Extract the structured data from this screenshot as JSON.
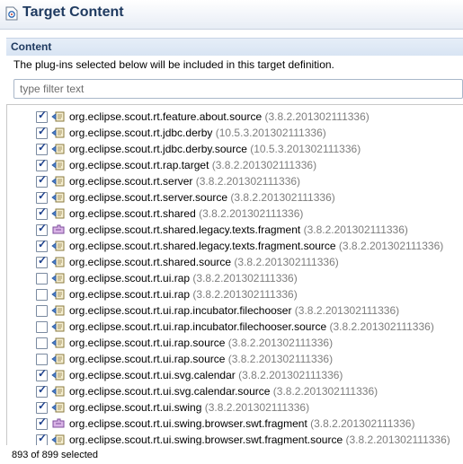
{
  "header": {
    "title": "Target Content",
    "icon": "target-definition-icon"
  },
  "section": {
    "title": "Content",
    "description": "The plug-ins selected below will be included in this target definition."
  },
  "filter": {
    "placeholder": "type filter text",
    "value": ""
  },
  "plugins": [
    {
      "name": "org.eclipse.scout.rt.feature.about.source",
      "version": "(3.8.2.201302111336)",
      "checked": true,
      "icon": "plugin-icon"
    },
    {
      "name": "org.eclipse.scout.rt.jdbc.derby",
      "version": "(10.5.3.201302111336)",
      "checked": true,
      "icon": "plugin-icon"
    },
    {
      "name": "org.eclipse.scout.rt.jdbc.derby.source",
      "version": "(10.5.3.201302111336)",
      "checked": true,
      "icon": "plugin-icon"
    },
    {
      "name": "org.eclipse.scout.rt.rap.target",
      "version": "(3.8.2.201302111336)",
      "checked": true,
      "icon": "plugin-icon"
    },
    {
      "name": "org.eclipse.scout.rt.server",
      "version": "(3.8.2.201302111336)",
      "checked": true,
      "icon": "plugin-icon"
    },
    {
      "name": "org.eclipse.scout.rt.server.source",
      "version": "(3.8.2.201302111336)",
      "checked": true,
      "icon": "plugin-icon"
    },
    {
      "name": "org.eclipse.scout.rt.shared",
      "version": "(3.8.2.201302111336)",
      "checked": true,
      "icon": "plugin-icon"
    },
    {
      "name": "org.eclipse.scout.rt.shared.legacy.texts.fragment",
      "version": "(3.8.2.201302111336)",
      "checked": true,
      "icon": "fragment-icon"
    },
    {
      "name": "org.eclipse.scout.rt.shared.legacy.texts.fragment.source",
      "version": "(3.8.2.201302111336)",
      "checked": true,
      "icon": "plugin-icon"
    },
    {
      "name": "org.eclipse.scout.rt.shared.source",
      "version": "(3.8.2.201302111336)",
      "checked": true,
      "icon": "plugin-icon"
    },
    {
      "name": "org.eclipse.scout.rt.ui.rap",
      "version": "(3.8.2.201302111336)",
      "checked": false,
      "icon": "plugin-icon"
    },
    {
      "name": "org.eclipse.scout.rt.ui.rap",
      "version": "(3.8.2.201302111336)",
      "checked": false,
      "icon": "plugin-icon"
    },
    {
      "name": "org.eclipse.scout.rt.ui.rap.incubator.filechooser",
      "version": "(3.8.2.201302111336)",
      "checked": false,
      "icon": "plugin-icon"
    },
    {
      "name": "org.eclipse.scout.rt.ui.rap.incubator.filechooser.source",
      "version": "(3.8.2.201302111336)",
      "checked": false,
      "icon": "plugin-icon"
    },
    {
      "name": "org.eclipse.scout.rt.ui.rap.source",
      "version": "(3.8.2.201302111336)",
      "checked": false,
      "icon": "plugin-icon"
    },
    {
      "name": "org.eclipse.scout.rt.ui.rap.source",
      "version": "(3.8.2.201302111336)",
      "checked": false,
      "icon": "plugin-icon"
    },
    {
      "name": "org.eclipse.scout.rt.ui.svg.calendar",
      "version": "(3.8.2.201302111336)",
      "checked": true,
      "icon": "plugin-icon"
    },
    {
      "name": "org.eclipse.scout.rt.ui.svg.calendar.source",
      "version": "(3.8.2.201302111336)",
      "checked": true,
      "icon": "plugin-icon"
    },
    {
      "name": "org.eclipse.scout.rt.ui.swing",
      "version": "(3.8.2.201302111336)",
      "checked": true,
      "icon": "plugin-icon"
    },
    {
      "name": "org.eclipse.scout.rt.ui.swing.browser.swt.fragment",
      "version": "(3.8.2.201302111336)",
      "checked": true,
      "icon": "fragment-icon"
    },
    {
      "name": "org.eclipse.scout.rt.ui.swing.browser.swt.fragment.source",
      "version": "(3.8.2.201302111336)",
      "checked": true,
      "icon": "plugin-icon"
    }
  ],
  "status": "893 of 899 selected"
}
